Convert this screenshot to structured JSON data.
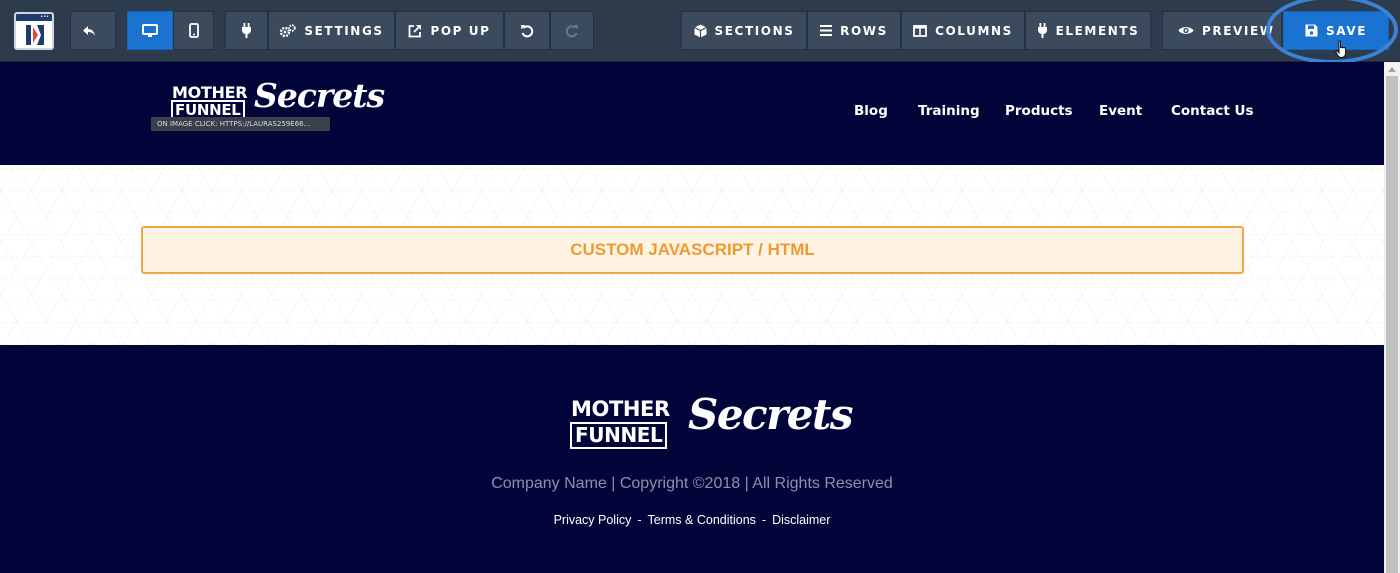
{
  "toolbar": {
    "back_label": "",
    "settings_label": "SETTINGS",
    "popup_label": "POP UP",
    "sections_label": "SECTIONS",
    "rows_label": "ROWS",
    "columns_label": "COLUMNS",
    "elements_label": "ELEMENTS",
    "preview_label": "PREVIEW",
    "save_label": "SAVE",
    "accent_color": "#1a73d0",
    "icons": [
      "app-logo-icon",
      "undo-arrow-icon",
      "desktop-icon",
      "mobile-icon",
      "plug-icon",
      "gears-icon",
      "external-link-icon",
      "undo-icon",
      "redo-icon",
      "cube-icon",
      "bars-icon",
      "columns-icon",
      "plug-icon",
      "eye-icon",
      "floppy-disk-icon",
      "hand-pointer-icon"
    ]
  },
  "header": {
    "brand_top": "MOTHER",
    "brand_bottom": "FUNNEL",
    "brand_script": "Secrets",
    "image_link_badge": "ON IMAGE CLICK: HTTPS://LAURAS259E66...",
    "nav": [
      "Blog",
      "Training",
      "Products",
      "Event",
      "Contact Us"
    ],
    "background_color": "#01053a"
  },
  "content": {
    "custom_block_label": "CUSTOM JAVASCRIPT / HTML",
    "block_color": "#ee9a33"
  },
  "footer": {
    "brand_top": "MOTHER",
    "brand_bottom": "FUNNEL",
    "brand_script": "Secrets",
    "copyright": "Company Name | Copyright ©2018 | All Rights Reserved",
    "links": [
      "Privacy Policy",
      "Terms & Conditions",
      "Disclaimer"
    ],
    "link_separator": "-"
  }
}
